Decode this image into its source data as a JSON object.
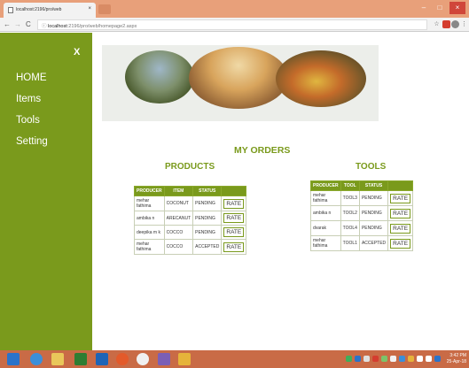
{
  "browser": {
    "tab_title": "localhost:2196/pro/web",
    "tab_close": "×",
    "url_host": "localhost",
    "url_rest": ":2196/pro/web/homepage2.aspx",
    "nav_back": "←",
    "nav_forward": "→",
    "nav_reload": "C",
    "info_icon": "ⓘ",
    "star_icon": "☆",
    "menu_icon": "⋮",
    "win_min": "–",
    "win_max": "□",
    "win_close": "×"
  },
  "sidebar": {
    "close": "X",
    "items": [
      {
        "label": "HOME"
      },
      {
        "label": "Items"
      },
      {
        "label": "Tools"
      },
      {
        "label": "Setting"
      }
    ]
  },
  "main": {
    "heading": "MY ORDERS",
    "products": {
      "title": "PRODUCTS",
      "headers": [
        "PRODUCER",
        "ITEM",
        "STATUS"
      ],
      "rows": [
        {
          "producer": "mehar fathima",
          "item": "COCONUT",
          "status": "PENDING",
          "action": "RATE"
        },
        {
          "producer": "ambika n",
          "item": "ARECANUT",
          "status": "PENDING",
          "action": "RATE"
        },
        {
          "producer": "deepika m k",
          "item": "COCCO",
          "status": "PENDING",
          "action": "RATE"
        },
        {
          "producer": "mehar fathima",
          "item": "COCCO",
          "status": "ACCEPTED",
          "action": "RATE"
        }
      ]
    },
    "tools": {
      "title": "TOOLS",
      "headers": [
        "PRODUCER",
        "TOOL",
        "STATUS"
      ],
      "rows": [
        {
          "producer": "mehar fathima",
          "tool": "TOOL3",
          "status": "PENDING",
          "action": "RATE"
        },
        {
          "producer": "ambika n",
          "tool": "TOOL2",
          "status": "PENDING",
          "action": "RATE"
        },
        {
          "producer": "dvarak",
          "tool": "TOOL4",
          "status": "PENDING",
          "action": "RATE"
        },
        {
          "producer": "mehar fathima",
          "tool": "TOOL1",
          "status": "ACCEPTED",
          "action": "RATE"
        }
      ]
    }
  },
  "taskbar": {
    "time": "3:42 PM",
    "date": "25-Apr-18"
  },
  "colors": {
    "accent": "#7a9a1c",
    "taskbar": "#c96b46",
    "tabbar": "#e8a07a"
  }
}
